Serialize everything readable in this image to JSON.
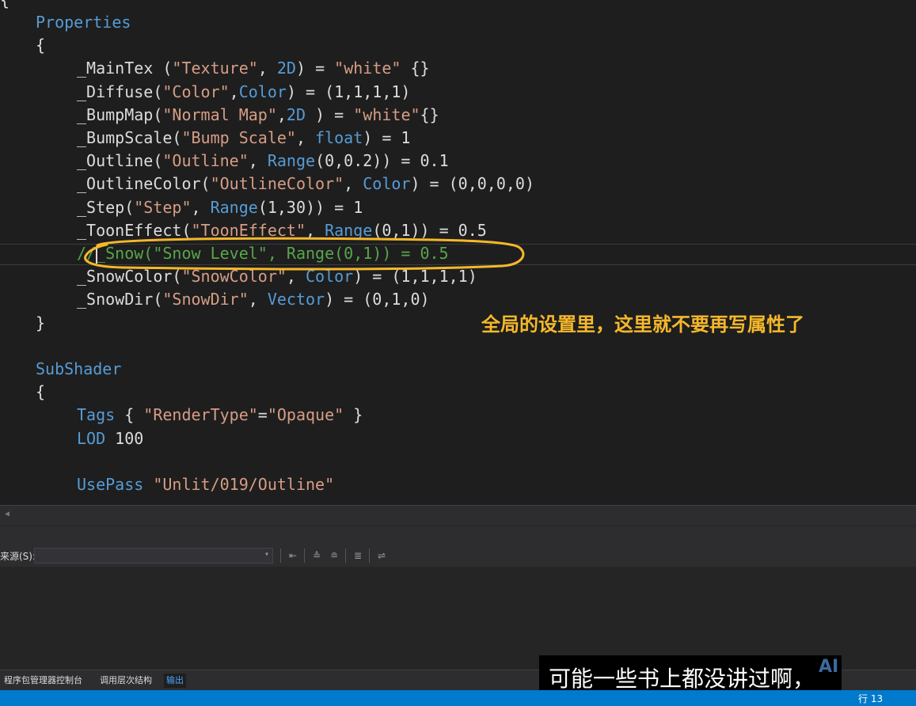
{
  "editor": {
    "top_fragment": "{",
    "lines": [
      [
        {
          "c": "kw",
          "t": "Properties"
        }
      ],
      [
        {
          "c": "pl",
          "t": "{"
        }
      ],
      [
        {
          "c": "id",
          "t": "_MainTex ("
        },
        {
          "c": "str",
          "t": "\"Texture\""
        },
        {
          "c": "id",
          "t": ", "
        },
        {
          "c": "kw",
          "t": "2D"
        },
        {
          "c": "id",
          "t": ") = "
        },
        {
          "c": "str",
          "t": "\"white\""
        },
        {
          "c": "id",
          "t": " {}"
        }
      ],
      [
        {
          "c": "id",
          "t": "_Diffuse("
        },
        {
          "c": "str",
          "t": "\"Color\""
        },
        {
          "c": "id",
          "t": ","
        },
        {
          "c": "kw",
          "t": "Color"
        },
        {
          "c": "id",
          "t": ") = (1,1,1,1)"
        }
      ],
      [
        {
          "c": "id",
          "t": "_BumpMap("
        },
        {
          "c": "str",
          "t": "\"Normal Map\""
        },
        {
          "c": "id",
          "t": ","
        },
        {
          "c": "kw",
          "t": "2D"
        },
        {
          "c": "id",
          "t": " ) = "
        },
        {
          "c": "str",
          "t": "\"white\""
        },
        {
          "c": "id",
          "t": "{}"
        }
      ],
      [
        {
          "c": "id",
          "t": "_BumpScale("
        },
        {
          "c": "str",
          "t": "\"Bump Scale\""
        },
        {
          "c": "id",
          "t": ", "
        },
        {
          "c": "kw",
          "t": "float"
        },
        {
          "c": "id",
          "t": ") = 1"
        }
      ],
      [
        {
          "c": "id",
          "t": "_Outline("
        },
        {
          "c": "str",
          "t": "\"Outline\""
        },
        {
          "c": "id",
          "t": ", "
        },
        {
          "c": "kw",
          "t": "Range"
        },
        {
          "c": "id",
          "t": "(0,0.2)) = 0.1"
        }
      ],
      [
        {
          "c": "id",
          "t": "_OutlineColor("
        },
        {
          "c": "str",
          "t": "\"OutlineColor\""
        },
        {
          "c": "id",
          "t": ", "
        },
        {
          "c": "kw",
          "t": "Color"
        },
        {
          "c": "id",
          "t": ") = (0,0,0,0)"
        }
      ],
      [
        {
          "c": "id",
          "t": "_Step("
        },
        {
          "c": "str",
          "t": "\"Step\""
        },
        {
          "c": "id",
          "t": ", "
        },
        {
          "c": "kw",
          "t": "Range"
        },
        {
          "c": "id",
          "t": "(1,30)) = 1"
        }
      ],
      [
        {
          "c": "id",
          "t": "_ToonEffect("
        },
        {
          "c": "str",
          "t": "\"ToonEffect\""
        },
        {
          "c": "id",
          "t": ", "
        },
        {
          "c": "kw",
          "t": "Range"
        },
        {
          "c": "id",
          "t": "(0,1)) = 0.5"
        }
      ],
      [
        {
          "c": "cm",
          "t": "//_Snow(\"Snow Level\", Range(0,1)) = 0.5"
        }
      ],
      [
        {
          "c": "id",
          "t": "_SnowColor("
        },
        {
          "c": "str",
          "t": "\"SnowColor\""
        },
        {
          "c": "id",
          "t": ", "
        },
        {
          "c": "kw",
          "t": "Color"
        },
        {
          "c": "id",
          "t": ") = (1,1,1,1)"
        }
      ],
      [
        {
          "c": "id",
          "t": "_SnowDir("
        },
        {
          "c": "str",
          "t": "\"SnowDir\""
        },
        {
          "c": "id",
          "t": ", "
        },
        {
          "c": "kw",
          "t": "Vector"
        },
        {
          "c": "id",
          "t": ") = (0,1,0)"
        }
      ],
      [
        {
          "c": "pl",
          "t": "}"
        }
      ],
      [],
      [
        {
          "c": "kw",
          "t": "SubShader"
        }
      ],
      [
        {
          "c": "pl",
          "t": "{"
        }
      ],
      [
        {
          "c": "kw",
          "t": "Tags"
        },
        {
          "c": "id",
          "t": " { "
        },
        {
          "c": "str",
          "t": "\"RenderType\""
        },
        {
          "c": "id",
          "t": "="
        },
        {
          "c": "str",
          "t": "\"Opaque\""
        },
        {
          "c": "id",
          "t": " }"
        }
      ],
      [
        {
          "c": "kw",
          "t": "LOD"
        },
        {
          "c": "id",
          "t": " 100"
        }
      ],
      [],
      [
        {
          "c": "kw",
          "t": "UsePass"
        },
        {
          "c": "id",
          "t": " "
        },
        {
          "c": "str",
          "t": "\"Unlit/019/Outline\""
        }
      ]
    ],
    "indent_levels": [
      1,
      1,
      2,
      2,
      2,
      2,
      2,
      2,
      2,
      2,
      2,
      2,
      2,
      1,
      0,
      1,
      1,
      2,
      2,
      0,
      2
    ]
  },
  "annotation": {
    "text": "全局的设置里，这里就不要再写属性了",
    "color": "#f5b82a"
  },
  "output_toolbar": {
    "source_label": "来源(S):",
    "source_value": ""
  },
  "bottom_tabs": {
    "items": [
      "程序包管理器控制台",
      "调用层次结构",
      "输出"
    ],
    "active": 2
  },
  "subtitle": {
    "text": "可能一些书上都没讲过啊，"
  },
  "watermark": {
    "text": "AI"
  },
  "statusbar": {
    "position": "行 13",
    "color": "#007acc"
  },
  "colors": {
    "keyword": "#569cd6",
    "string": "#d69d85",
    "comment": "#57a64a",
    "text": "#dcdcdc",
    "background": "#1e1e1e"
  }
}
